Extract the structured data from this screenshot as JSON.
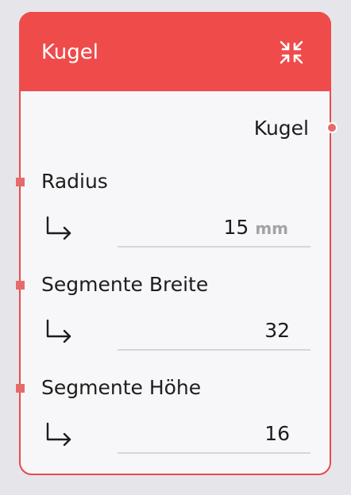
{
  "node": {
    "title": "Kugel",
    "collapse_icon": "collapse-arrows-icon",
    "output": {
      "label": "Kugel"
    },
    "params": [
      {
        "label": "Radius",
        "value": "15",
        "unit": "mm"
      },
      {
        "label": "Segmente Breite",
        "value": "32",
        "unit": ""
      },
      {
        "label": "Segmente Höhe",
        "value": "16",
        "unit": ""
      }
    ],
    "colors": {
      "header": "#ef4b4b",
      "border": "#ea4a4a",
      "port": "#e76a6a"
    }
  }
}
